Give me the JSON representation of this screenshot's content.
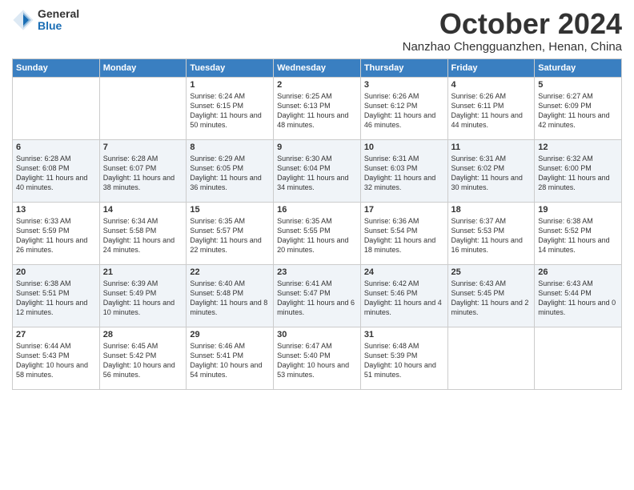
{
  "logo": {
    "general": "General",
    "blue": "Blue"
  },
  "header": {
    "month": "October 2024",
    "location": "Nanzhao Chengguanzhen, Henan, China"
  },
  "days_of_week": [
    "Sunday",
    "Monday",
    "Tuesday",
    "Wednesday",
    "Thursday",
    "Friday",
    "Saturday"
  ],
  "weeks": [
    [
      {
        "day": "",
        "content": ""
      },
      {
        "day": "",
        "content": ""
      },
      {
        "day": "1",
        "content": "Sunrise: 6:24 AM\nSunset: 6:15 PM\nDaylight: 11 hours and 50 minutes."
      },
      {
        "day": "2",
        "content": "Sunrise: 6:25 AM\nSunset: 6:13 PM\nDaylight: 11 hours and 48 minutes."
      },
      {
        "day": "3",
        "content": "Sunrise: 6:26 AM\nSunset: 6:12 PM\nDaylight: 11 hours and 46 minutes."
      },
      {
        "day": "4",
        "content": "Sunrise: 6:26 AM\nSunset: 6:11 PM\nDaylight: 11 hours and 44 minutes."
      },
      {
        "day": "5",
        "content": "Sunrise: 6:27 AM\nSunset: 6:09 PM\nDaylight: 11 hours and 42 minutes."
      }
    ],
    [
      {
        "day": "6",
        "content": "Sunrise: 6:28 AM\nSunset: 6:08 PM\nDaylight: 11 hours and 40 minutes."
      },
      {
        "day": "7",
        "content": "Sunrise: 6:28 AM\nSunset: 6:07 PM\nDaylight: 11 hours and 38 minutes."
      },
      {
        "day": "8",
        "content": "Sunrise: 6:29 AM\nSunset: 6:05 PM\nDaylight: 11 hours and 36 minutes."
      },
      {
        "day": "9",
        "content": "Sunrise: 6:30 AM\nSunset: 6:04 PM\nDaylight: 11 hours and 34 minutes."
      },
      {
        "day": "10",
        "content": "Sunrise: 6:31 AM\nSunset: 6:03 PM\nDaylight: 11 hours and 32 minutes."
      },
      {
        "day": "11",
        "content": "Sunrise: 6:31 AM\nSunset: 6:02 PM\nDaylight: 11 hours and 30 minutes."
      },
      {
        "day": "12",
        "content": "Sunrise: 6:32 AM\nSunset: 6:00 PM\nDaylight: 11 hours and 28 minutes."
      }
    ],
    [
      {
        "day": "13",
        "content": "Sunrise: 6:33 AM\nSunset: 5:59 PM\nDaylight: 11 hours and 26 minutes."
      },
      {
        "day": "14",
        "content": "Sunrise: 6:34 AM\nSunset: 5:58 PM\nDaylight: 11 hours and 24 minutes."
      },
      {
        "day": "15",
        "content": "Sunrise: 6:35 AM\nSunset: 5:57 PM\nDaylight: 11 hours and 22 minutes."
      },
      {
        "day": "16",
        "content": "Sunrise: 6:35 AM\nSunset: 5:55 PM\nDaylight: 11 hours and 20 minutes."
      },
      {
        "day": "17",
        "content": "Sunrise: 6:36 AM\nSunset: 5:54 PM\nDaylight: 11 hours and 18 minutes."
      },
      {
        "day": "18",
        "content": "Sunrise: 6:37 AM\nSunset: 5:53 PM\nDaylight: 11 hours and 16 minutes."
      },
      {
        "day": "19",
        "content": "Sunrise: 6:38 AM\nSunset: 5:52 PM\nDaylight: 11 hours and 14 minutes."
      }
    ],
    [
      {
        "day": "20",
        "content": "Sunrise: 6:38 AM\nSunset: 5:51 PM\nDaylight: 11 hours and 12 minutes."
      },
      {
        "day": "21",
        "content": "Sunrise: 6:39 AM\nSunset: 5:49 PM\nDaylight: 11 hours and 10 minutes."
      },
      {
        "day": "22",
        "content": "Sunrise: 6:40 AM\nSunset: 5:48 PM\nDaylight: 11 hours and 8 minutes."
      },
      {
        "day": "23",
        "content": "Sunrise: 6:41 AM\nSunset: 5:47 PM\nDaylight: 11 hours and 6 minutes."
      },
      {
        "day": "24",
        "content": "Sunrise: 6:42 AM\nSunset: 5:46 PM\nDaylight: 11 hours and 4 minutes."
      },
      {
        "day": "25",
        "content": "Sunrise: 6:43 AM\nSunset: 5:45 PM\nDaylight: 11 hours and 2 minutes."
      },
      {
        "day": "26",
        "content": "Sunrise: 6:43 AM\nSunset: 5:44 PM\nDaylight: 11 hours and 0 minutes."
      }
    ],
    [
      {
        "day": "27",
        "content": "Sunrise: 6:44 AM\nSunset: 5:43 PM\nDaylight: 10 hours and 58 minutes."
      },
      {
        "day": "28",
        "content": "Sunrise: 6:45 AM\nSunset: 5:42 PM\nDaylight: 10 hours and 56 minutes."
      },
      {
        "day": "29",
        "content": "Sunrise: 6:46 AM\nSunset: 5:41 PM\nDaylight: 10 hours and 54 minutes."
      },
      {
        "day": "30",
        "content": "Sunrise: 6:47 AM\nSunset: 5:40 PM\nDaylight: 10 hours and 53 minutes."
      },
      {
        "day": "31",
        "content": "Sunrise: 6:48 AM\nSunset: 5:39 PM\nDaylight: 10 hours and 51 minutes."
      },
      {
        "day": "",
        "content": ""
      },
      {
        "day": "",
        "content": ""
      }
    ]
  ]
}
